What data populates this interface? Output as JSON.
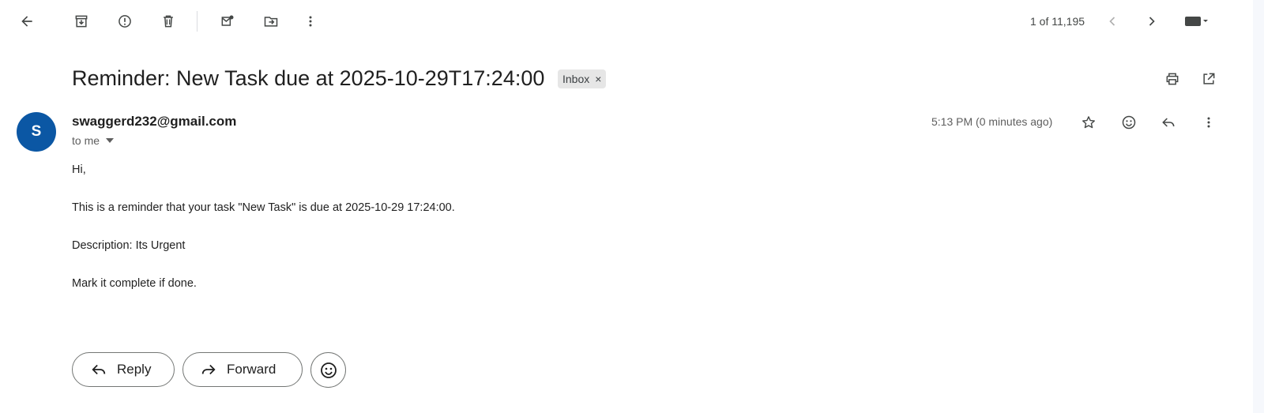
{
  "toolbar": {
    "icons": {
      "back": "arrow-back-icon",
      "archive": "archive-icon",
      "spam": "report-spam-icon",
      "delete": "trash-icon",
      "mark_unread": "mark-unread-icon",
      "move": "move-to-icon",
      "more": "more-vertical-icon",
      "prev": "chevron-left-icon",
      "next": "chevron-right-icon",
      "keyboard": "keyboard-icon"
    },
    "pager_text": "1 of 11,195"
  },
  "message": {
    "subject": "Reminder: New Task due at 2025-10-29T17:24:00",
    "label": "Inbox",
    "label_remove": "×",
    "sender_initial": "S",
    "sender_email": "swaggerd232@gmail.com",
    "recipient_text": "to me",
    "time": "5:13 PM (0 minutes ago)",
    "body": [
      "Hi,",
      "This is a reminder that your task \"New Task\" is due at 2025-10-29 17:24:00.",
      "Description: Its Urgent",
      "Mark it complete if done."
    ]
  },
  "actions": {
    "reply_label": "Reply",
    "forward_label": "Forward"
  },
  "colors": {
    "avatar_bg": "#0b57a4",
    "label_chip_bg": "#e6e6e6",
    "page_bg": "#ffffff"
  }
}
